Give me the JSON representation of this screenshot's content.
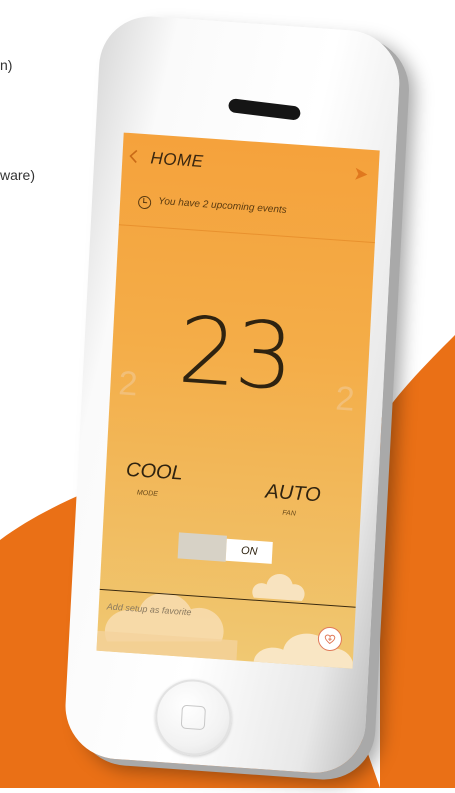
{
  "background": {
    "line1": "n)",
    "line2": "ware)",
    "accent": "#ea7016"
  },
  "app": {
    "title": "HOME",
    "events_text": "You have 2 upcoming events",
    "temperature": "23",
    "temp_prev": "2",
    "temp_next": "2",
    "mode_value": "COOL",
    "mode_label": "MODE",
    "fan_value": "AUTO",
    "fan_label": "FAN",
    "toggle_label": "ON",
    "favorite_text": "Add setup as favorite",
    "icons": [
      "back-chevron-icon",
      "send-icon",
      "clock-icon",
      "heart-plus-icon"
    ]
  }
}
